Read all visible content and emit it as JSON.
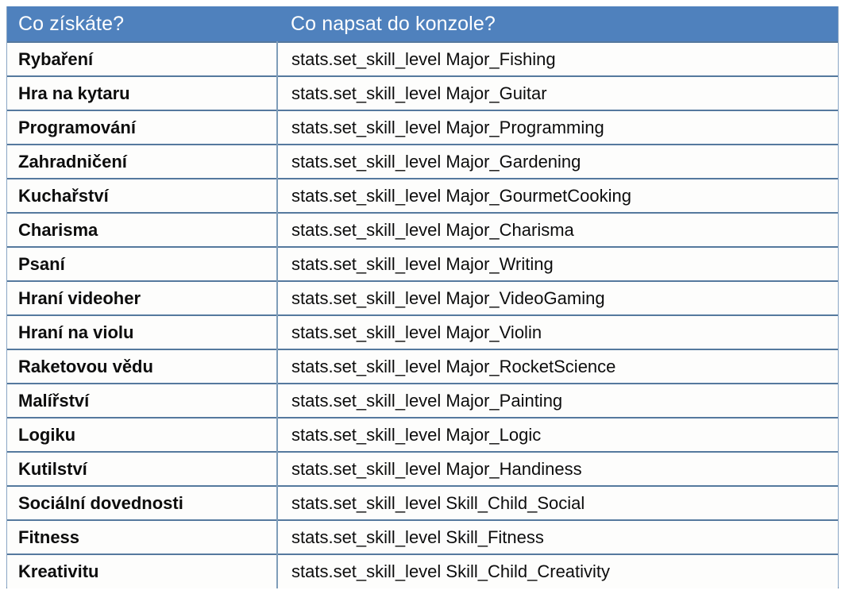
{
  "table": {
    "headers": {
      "skill": "Co získáte?",
      "cheat": "Co napsat do konzole?"
    },
    "colors": {
      "header_background": "#4F81BD",
      "header_text": "#FFFFFF",
      "row_separator": "#55799E",
      "column_divider": "#7F9DB9",
      "cell_background": "#FDFDFC",
      "cell_text": "#0D0D0D"
    },
    "rows": [
      {
        "skill": "Rybaření",
        "cheat": "stats.set_skill_level Major_Fishing"
      },
      {
        "skill": "Hra na kytaru",
        "cheat": "stats.set_skill_level Major_Guitar"
      },
      {
        "skill": "Programování",
        "cheat": "stats.set_skill_level Major_Programming"
      },
      {
        "skill": "Zahradničení",
        "cheat": "stats.set_skill_level Major_Gardening"
      },
      {
        "skill": "Kuchařství",
        "cheat": "stats.set_skill_level Major_GourmetCooking"
      },
      {
        "skill": "Charisma",
        "cheat": "stats.set_skill_level Major_Charisma"
      },
      {
        "skill": "Psaní",
        "cheat": "stats.set_skill_level Major_Writing"
      },
      {
        "skill": "Hraní videoher",
        "cheat": "stats.set_skill_level Major_VideoGaming"
      },
      {
        "skill": "Hraní na violu",
        "cheat": "stats.set_skill_level Major_Violin"
      },
      {
        "skill": "Raketovou vědu",
        "cheat": "stats.set_skill_level Major_RocketScience"
      },
      {
        "skill": "Malířství",
        "cheat": "stats.set_skill_level Major_Painting"
      },
      {
        "skill": "Logiku",
        "cheat": "stats.set_skill_level Major_Logic"
      },
      {
        "skill": "Kutilství",
        "cheat": "stats.set_skill_level Major_Handiness"
      },
      {
        "skill": "Sociální dovednosti",
        "cheat": "stats.set_skill_level Skill_Child_Social"
      },
      {
        "skill": "Fitness",
        "cheat": "stats.set_skill_level Skill_Fitness"
      },
      {
        "skill": "Kreativitu",
        "cheat": "stats.set_skill_level Skill_Child_Creativity"
      }
    ]
  }
}
